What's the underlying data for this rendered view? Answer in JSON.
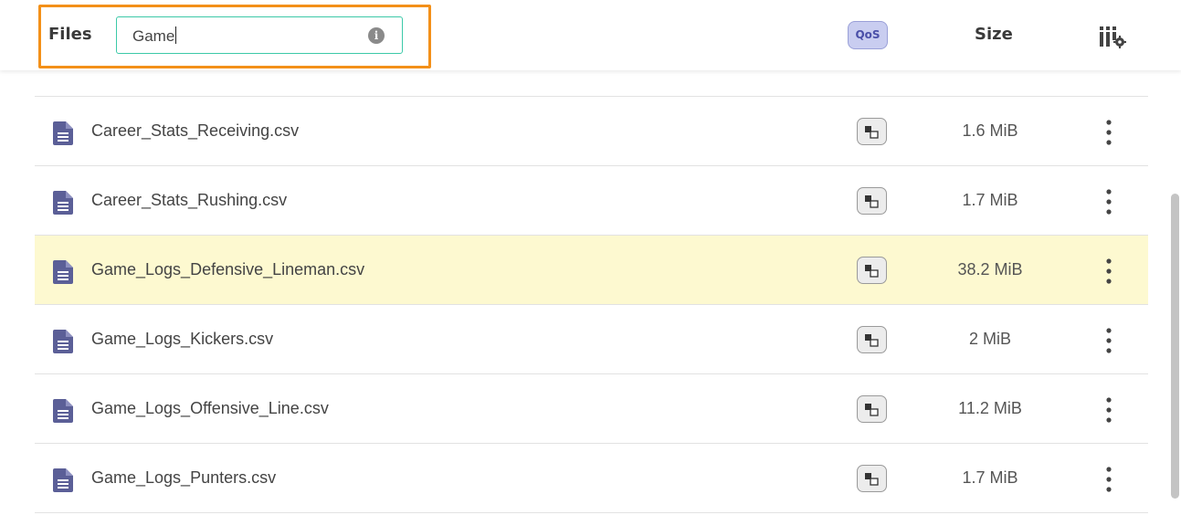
{
  "header": {
    "files_label": "Files",
    "search_value": "Game",
    "qos_label": "QoS",
    "size_label": "Size"
  },
  "files": [
    {
      "name": "Career_Stats_Receiving.csv",
      "size": "1.6 MiB",
      "selected": false
    },
    {
      "name": "Career_Stats_Rushing.csv",
      "size": "1.7 MiB",
      "selected": false
    },
    {
      "name": "Game_Logs_Defensive_Lineman.csv",
      "size": "38.2 MiB",
      "selected": true
    },
    {
      "name": "Game_Logs_Kickers.csv",
      "size": "2 MiB",
      "selected": false
    },
    {
      "name": "Game_Logs_Offensive_Line.csv",
      "size": "11.2 MiB",
      "selected": false
    },
    {
      "name": "Game_Logs_Punters.csv",
      "size": "1.7 MiB",
      "selected": false
    }
  ],
  "colors": {
    "highlight_border": "#f39019",
    "search_border": "#3cc9a8",
    "selected_row": "#fdf9d0",
    "file_icon": "#5b5f97",
    "qos_badge": "#c9cdf0"
  },
  "icons": {
    "file": "file-text-icon",
    "qos": "qos-icon",
    "more": "kebab-menu-icon",
    "columns": "column-settings-icon",
    "info": "info-icon"
  }
}
